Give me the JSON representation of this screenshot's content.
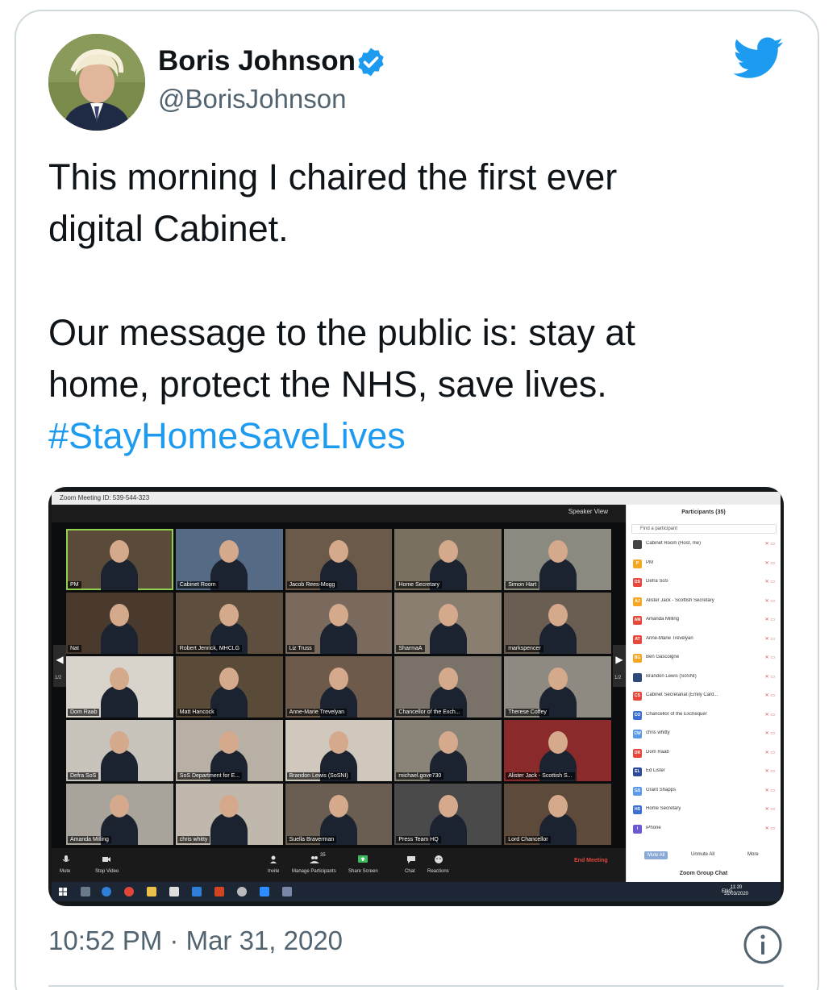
{
  "tweet": {
    "author_name": "Boris Johnson",
    "author_handle": "@BorisJohnson",
    "verified": true,
    "text_line1": "This morning I chaired the first ever",
    "text_line2": "digital Cabinet.",
    "text_line3": "Our message to the public is: stay at",
    "text_line4": "home, protect the NHS, save lives.",
    "hashtag": "#StayHomeSaveLives",
    "timestamp": "10:52 PM · Mar 31, 2020",
    "icons": [
      "verified-badge-icon",
      "twitter-bird-icon",
      "info-icon"
    ],
    "colors": {
      "accent": "#1d9bf0",
      "text": "#0f1419",
      "muted": "#536471"
    }
  },
  "zoom": {
    "window_title": "Zoom Meeting ID: 539-544-323",
    "speaker_view_label": "Speaker View",
    "page_indicator": "1/2",
    "tiles": [
      {
        "label": "PM",
        "bg": "#5a4a3a"
      },
      {
        "label": "Cabinet Room",
        "bg": "#556b85"
      },
      {
        "label": "Jacob Rees-Mogg",
        "bg": "#6b5a4a"
      },
      {
        "label": "Home Secretary",
        "bg": "#7a7060"
      },
      {
        "label": "Simon Hart",
        "bg": "#8a8a80"
      },
      {
        "label": "Nat",
        "bg": "#4a3a2e"
      },
      {
        "label": "Robert Jenrick, MHCLG",
        "bg": "#5e4e3e"
      },
      {
        "label": "Liz Truss",
        "bg": "#7a6a5e"
      },
      {
        "label": "SharmaA",
        "bg": "#8a7e70"
      },
      {
        "label": "markspencer",
        "bg": "#6a5e52"
      },
      {
        "label": "Dom Raab",
        "bg": "#d8d4cc"
      },
      {
        "label": "Matt Hancock",
        "bg": "#5a4a38"
      },
      {
        "label": "Anne-Marie Trevelyan",
        "bg": "#6e5a4a"
      },
      {
        "label": "Chancellor of the Exch...",
        "bg": "#7a7268"
      },
      {
        "label": "Therese Coffey",
        "bg": "#8e8a82"
      },
      {
        "label": "Defra SoS",
        "bg": "#c8c4bc"
      },
      {
        "label": "SoS Department for E...",
        "bg": "#b8b0a4"
      },
      {
        "label": "Brandon Lewis (SoSNI)",
        "bg": "#d0c8bc"
      },
      {
        "label": "michael.gove730",
        "bg": "#8a8478"
      },
      {
        "label": "Alister Jack - Scottish S...",
        "bg": "#8a2a2a"
      },
      {
        "label": "Amanda Milling",
        "bg": "#a8a49c"
      },
      {
        "label": "chris whitty",
        "bg": "#c0b8ac"
      },
      {
        "label": "Suella Braverman",
        "bg": "#6a5e52"
      },
      {
        "label": "Press Team HQ",
        "bg": "#4a4a4a"
      },
      {
        "label": "Lord Chancellor",
        "bg": "#5e4a3a"
      }
    ],
    "controls": [
      "Mute",
      "Stop Video",
      "Invite",
      "Manage Participants",
      "Share Screen",
      "Chat",
      "Reactions"
    ],
    "participant_count": "35",
    "end_meeting": "End Meeting",
    "participants_panel": {
      "title": "Participants (35)",
      "search_placeholder": "Find a participant",
      "rows": [
        {
          "badge": "",
          "name": "Cabinet Room (Host, me)",
          "color": "#444444"
        },
        {
          "badge": "P",
          "name": "PM",
          "color": "#f5a623"
        },
        {
          "badge": "DS",
          "name": "Defra SoS",
          "color": "#e8473b"
        },
        {
          "badge": "AJ",
          "name": "Alister Jack - Scottish Secretary",
          "color": "#f5a623"
        },
        {
          "badge": "AM",
          "name": "Amanda Milling",
          "color": "#e8473b"
        },
        {
          "badge": "AT",
          "name": "Anne-Marie Trevelyan",
          "color": "#e8473b"
        },
        {
          "badge": "BG",
          "name": "Ben Gascoigne",
          "color": "#f5a623"
        },
        {
          "badge": "",
          "name": "Brandon Lewis (SoSNI)",
          "color": "#2d4a7a"
        },
        {
          "badge": "CS",
          "name": "Cabinet Secretariat (Emily Card...",
          "color": "#e8473b"
        },
        {
          "badge": "CO",
          "name": "Chancellor of the Exchequer",
          "color": "#3b6fd1"
        },
        {
          "badge": "CW",
          "name": "chris whitty",
          "color": "#5b9ae8"
        },
        {
          "badge": "DR",
          "name": "Dom Raab",
          "color": "#e8473b"
        },
        {
          "badge": "EL",
          "name": "Ed Lister",
          "color": "#2d4a9a"
        },
        {
          "badge": "GS",
          "name": "Grant Shapps",
          "color": "#5b9ae8"
        },
        {
          "badge": "HS",
          "name": "Home Secretary",
          "color": "#3b6fd1"
        },
        {
          "badge": "i",
          "name": "iPhone",
          "color": "#6a5ad1"
        }
      ],
      "mute_all": "Mute All",
      "unmute_all": "Unmute All",
      "more": "More",
      "chat_title": "Zoom Group Chat"
    },
    "taskbar": {
      "lang": "ENG",
      "time": "11:20",
      "date": "31/03/2020"
    }
  }
}
